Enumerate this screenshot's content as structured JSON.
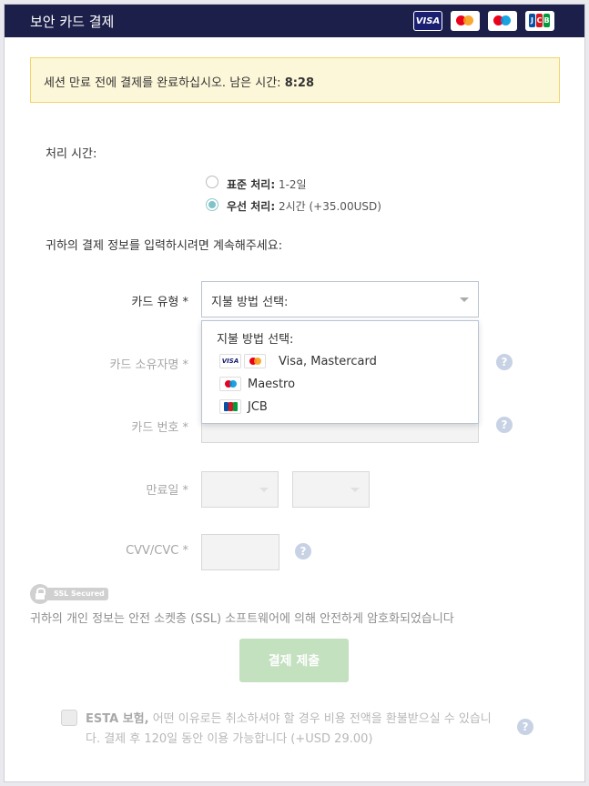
{
  "header": {
    "title": "보안 카드 결제",
    "cards": [
      "VISA",
      "mastercard",
      "maestro",
      "JCB"
    ]
  },
  "timer": {
    "message": "세션 만료 전에 결제를 완료하십시오. 남은 시간: ",
    "value": "8:28"
  },
  "processing": {
    "label": "처리 시간:",
    "options": [
      {
        "title": "표준 처리:",
        "detail": " 1-2일",
        "selected": false
      },
      {
        "title": "우선 처리:",
        "detail": " 2시간 (+35.00USD)",
        "selected": true
      }
    ]
  },
  "instruction": "귀하의 결제 정보를 입력하시려면 계속해주세요:",
  "form": {
    "card_type_label": "카드 유형 *",
    "card_type_selected": "지불 방법 선택:",
    "card_holder_label": "카드 소유자명 *",
    "card_number_label": "카드 번호 *",
    "expiry_label": "만료일 *",
    "cvv_label": "CVV/CVC *",
    "help_glyph": "?"
  },
  "dropdown": {
    "header": "지불 방법 선택:",
    "items": [
      {
        "label": "Visa, Mastercard",
        "icons": [
          "visa-icon",
          "mastercard-icon"
        ]
      },
      {
        "label": "Maestro",
        "icons": [
          "maestro-icon"
        ]
      },
      {
        "label": "JCB",
        "icons": [
          "jcb-icon"
        ]
      }
    ]
  },
  "ssl": {
    "badge": "SSL Secured",
    "text": "귀하의 개인 정보는 안전 소켓층 (SSL) 소프트웨어에 의해 안전하게 암호화되었습니다"
  },
  "submit_label": "결제 제출",
  "insurance": {
    "title": "ESTA 보험,",
    "text": " 어떤 이유로든 취소하셔야 할 경우 비용 전액을 환불받으실 수 있습니다. 결제 후 120일 동안 이용 가능합니다 (+USD 29.00)"
  },
  "colors": {
    "header_bg": "#1c1f4a",
    "timer_bg": "#fdf7d9",
    "timer_border": "#f0d56a",
    "radio_checked": "#7fc3c8",
    "submit_bg": "#c3e0bf",
    "help_icon": "#c7d2e4"
  }
}
